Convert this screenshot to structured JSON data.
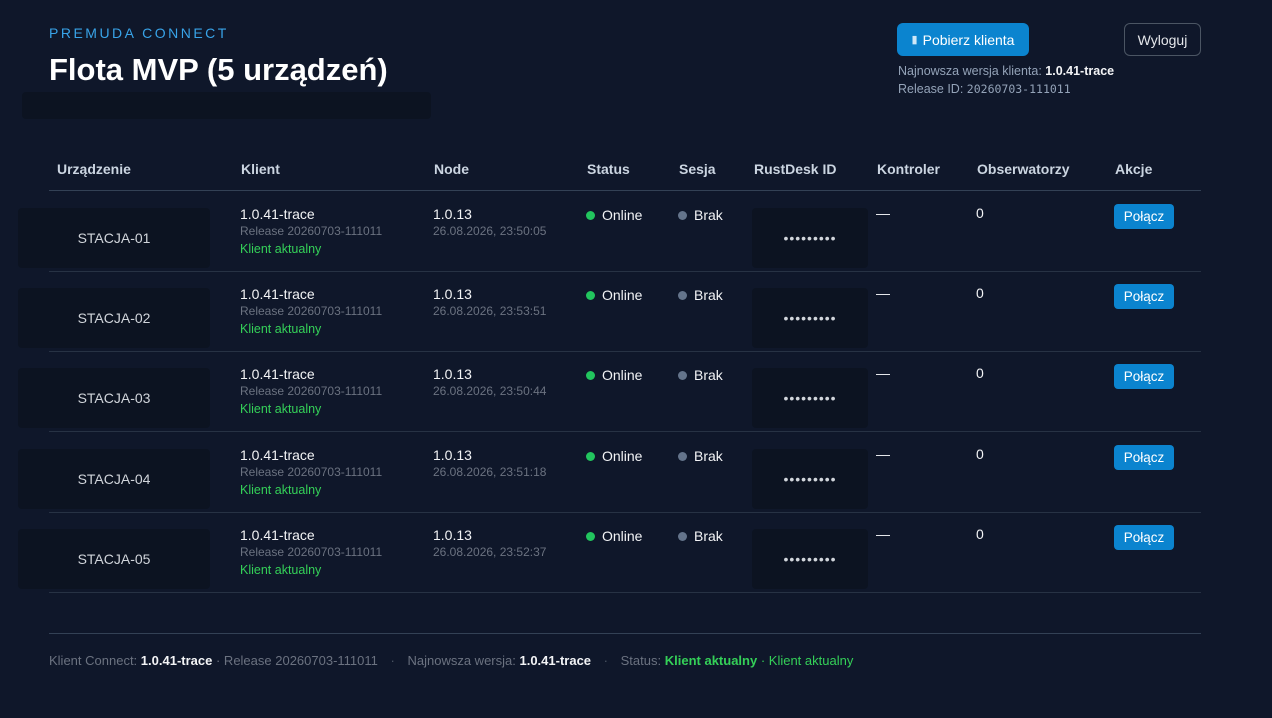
{
  "header": {
    "brand": "PREMUDA CONNECT",
    "title": "Flota MVP (5 urządzeń)",
    "download_button": "Pobierz klienta",
    "logout_button": "Wyloguj",
    "latest_label": "Najnowsza wersja klienta:",
    "latest_version": "1.0.41-trace",
    "release_label": "Release ID:",
    "release_id": "20260703-111011"
  },
  "table": {
    "headers": {
      "device": "Urządzenie",
      "client": "Klient",
      "node": "Node",
      "status": "Status",
      "session": "Sesja",
      "rustdesk": "RustDesk ID",
      "controller": "Kontroler",
      "observers": "Obserwatorzy",
      "actions": "Akcje"
    },
    "rows": [
      {
        "device": "STACJA-01",
        "client_version": "1.0.41-trace",
        "client_release": "Release 20260703-111011",
        "client_status": "Klient aktualny",
        "node_version": "1.0.13",
        "node_time": "26.08.2026, 23:50:05",
        "status": "Online",
        "session": "Brak",
        "rustdesk_pw": "•••••••••",
        "controller": "—",
        "observers": "0",
        "action": "Połącz"
      },
      {
        "device": "STACJA-02",
        "client_version": "1.0.41-trace",
        "client_release": "Release 20260703-111011",
        "client_status": "Klient aktualny",
        "node_version": "1.0.13",
        "node_time": "26.08.2026, 23:53:51",
        "status": "Online",
        "session": "Brak",
        "rustdesk_pw": "•••••••••",
        "controller": "—",
        "observers": "0",
        "action": "Połącz"
      },
      {
        "device": "STACJA-03",
        "client_version": "1.0.41-trace",
        "client_release": "Release 20260703-111011",
        "client_status": "Klient aktualny",
        "node_version": "1.0.13",
        "node_time": "26.08.2026, 23:50:44",
        "status": "Online",
        "session": "Brak",
        "rustdesk_pw": "•••••••••",
        "controller": "—",
        "observers": "0",
        "action": "Połącz"
      },
      {
        "device": "STACJA-04",
        "client_version": "1.0.41-trace",
        "client_release": "Release 20260703-111011",
        "client_status": "Klient aktualny",
        "node_version": "1.0.13",
        "node_time": "26.08.2026, 23:51:18",
        "status": "Online",
        "session": "Brak",
        "rustdesk_pw": "•••••••••",
        "controller": "—",
        "observers": "0",
        "action": "Połącz"
      },
      {
        "device": "STACJA-05",
        "client_version": "1.0.41-trace",
        "client_release": "Release 20260703-111011",
        "client_status": "Klient aktualny",
        "node_version": "1.0.13",
        "node_time": "26.08.2026, 23:52:37",
        "status": "Online",
        "session": "Brak",
        "rustdesk_pw": "•••••••••",
        "controller": "—",
        "observers": "0",
        "action": "Połącz"
      }
    ]
  },
  "footer": {
    "client_label": "Klient Connect:",
    "client_version": "1.0.41-trace",
    "client_release": "· Release 20260703-111011",
    "sep1": "·",
    "latest_label": "Najnowsza wersja:",
    "latest_version": "1.0.41-trace",
    "sep2": "·",
    "status_label": "Status:",
    "status_bold": "Klient aktualny",
    "status_rest": "· Klient aktualny"
  },
  "colors": {
    "background": "#0f172a",
    "accent": "#0b84cf",
    "online": "#22c55e",
    "ok_text": "#34d058"
  },
  "icons": {
    "download": "client-download-icon",
    "status_online": "green-dot",
    "session_none": "gray-dot"
  }
}
